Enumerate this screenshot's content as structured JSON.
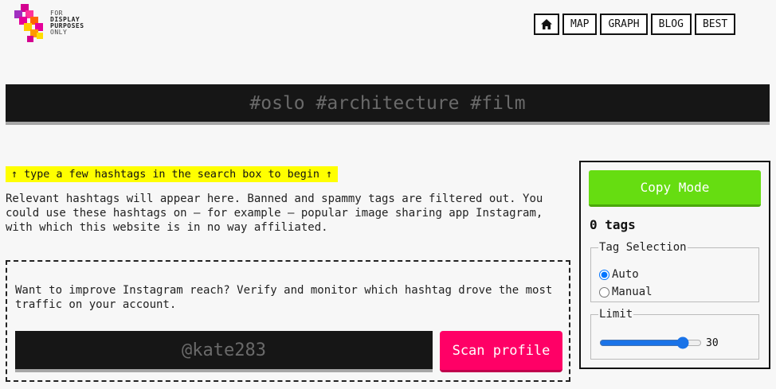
{
  "brand": {
    "logo_lines": [
      "FOR",
      "DISPLAY",
      "PURPOSES",
      "ONLY"
    ],
    "colors": {
      "magenta": "#e6009a",
      "yellow": "#ffcc00",
      "orange": "#ff6600",
      "purple": "#a030c0"
    }
  },
  "nav": {
    "home_icon": "home-icon",
    "items": [
      {
        "label": "MAP"
      },
      {
        "label": "GRAPH"
      },
      {
        "label": "BLOG"
      },
      {
        "label": "BEST"
      }
    ]
  },
  "search": {
    "placeholder": "#oslo #architecture #film",
    "value": ""
  },
  "main": {
    "hint": "↑ type a few hashtags in the search box to begin ↑",
    "description": "Relevant hashtags will appear here. Banned and spammy tags are filtered out. You could use these hashtags on – for example – popular image sharing app Instagram, with which this website is in no way affiliated."
  },
  "promo": {
    "text": "Want to improve Instagram reach? Verify and monitor which hashtag drove the most traffic on your account.",
    "account_placeholder": "@kate283",
    "scan_label": "Scan profile",
    "scan_color": "#ff0066"
  },
  "panel": {
    "copy_label": "Copy Mode",
    "copy_color": "#66dd11",
    "tag_count": "0 tags",
    "selection_legend": "Tag Selection",
    "options": [
      {
        "label": "Auto",
        "checked": true
      },
      {
        "label": "Manual",
        "checked": false
      }
    ],
    "limit_legend": "Limit",
    "limit_value": "30",
    "limit_max": "35"
  }
}
